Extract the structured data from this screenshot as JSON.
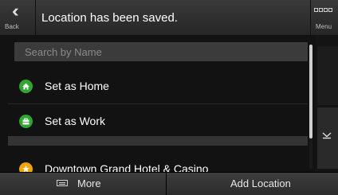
{
  "header": {
    "back_label": "Back",
    "title": "Location has been saved.",
    "menu_label": "Menu"
  },
  "search": {
    "placeholder": "Search by Name"
  },
  "list": {
    "items": [
      {
        "label": "Set as Home",
        "icon": "home-icon",
        "color": "#2fa62f"
      },
      {
        "label": "Set as Work",
        "icon": "briefcase-icon",
        "color": "#2fa62f"
      },
      {
        "label": "Downtown Grand Hotel & Casino",
        "icon": "star-icon",
        "color": "#f2a400"
      }
    ]
  },
  "bottom": {
    "more_label": "More",
    "add_label": "Add Location"
  }
}
